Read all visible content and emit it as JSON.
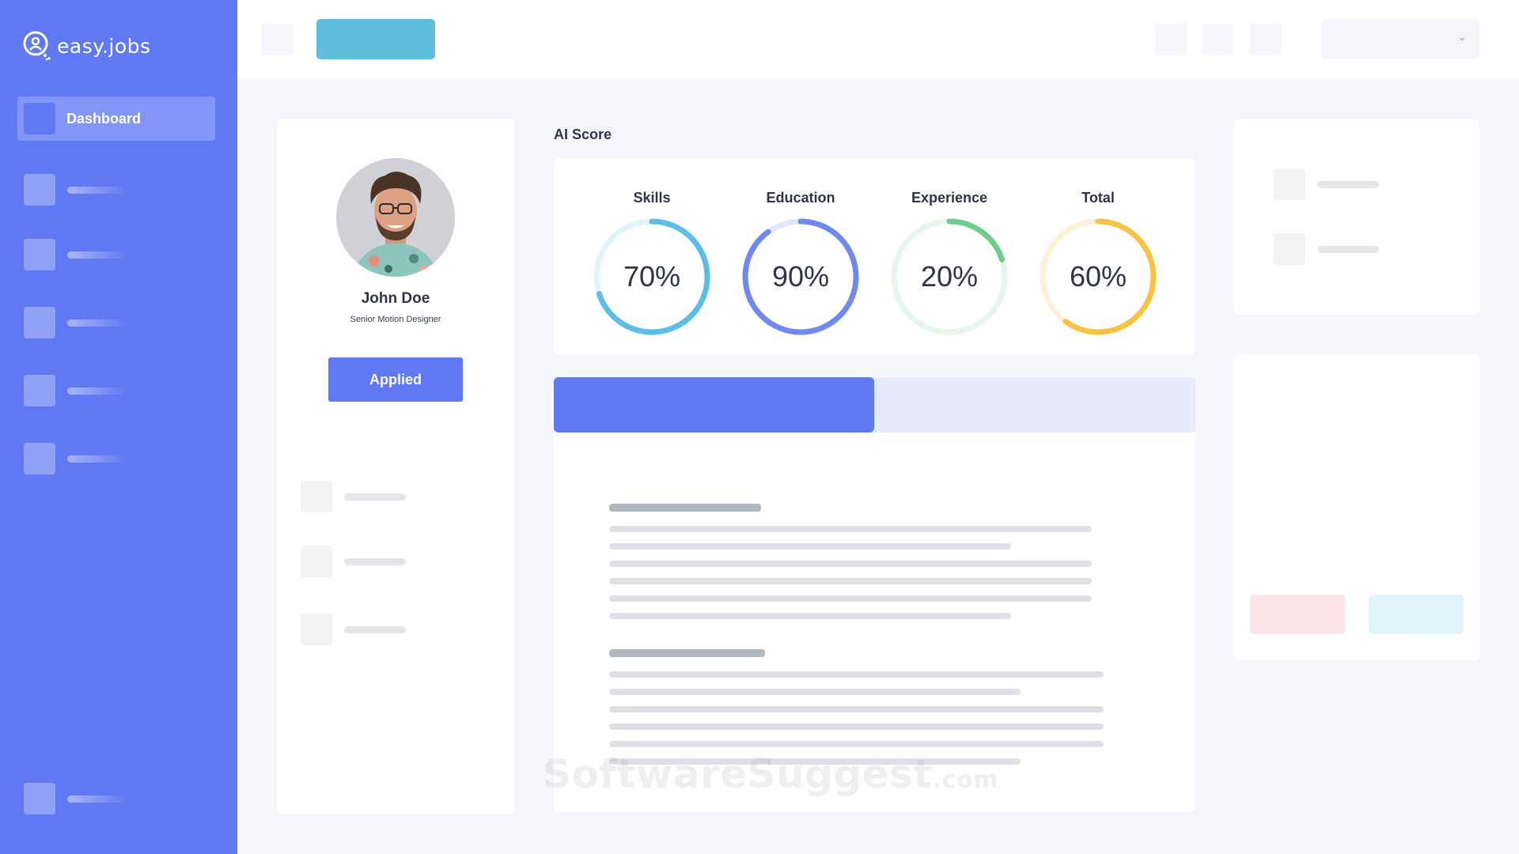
{
  "app": {
    "logo_text": "easy.jobs"
  },
  "sidebar": {
    "active_item": {
      "label": "Dashboard"
    }
  },
  "candidate": {
    "name": "John Doe",
    "role": "Senior Motion Designer",
    "status_button": "Applied"
  },
  "ai_score": {
    "title": "AI Score",
    "scores": [
      {
        "label": "Skills",
        "value": "70%",
        "fraction": 0.7,
        "color": "#5bbde8",
        "track": "#e2f3fb"
      },
      {
        "label": "Education",
        "value": "90%",
        "fraction": 0.9,
        "color": "#7089ee",
        "track": "#e2e8fc"
      },
      {
        "label": "Experience",
        "value": "20%",
        "fraction": 0.2,
        "color": "#6fcd8a",
        "track": "#e6f6ea"
      },
      {
        "label": "Total",
        "value": "60%",
        "fraction": 0.6,
        "color": "#f6c342",
        "track": "#fdf1d6"
      }
    ]
  },
  "colors": {
    "sidebar": "#6079f3",
    "primary": "#6079f3",
    "accent_button": "#5fbedc",
    "background": "#f4f6fb"
  },
  "watermark": {
    "main": "SoftwareSuggest",
    "suffix": ".com"
  }
}
